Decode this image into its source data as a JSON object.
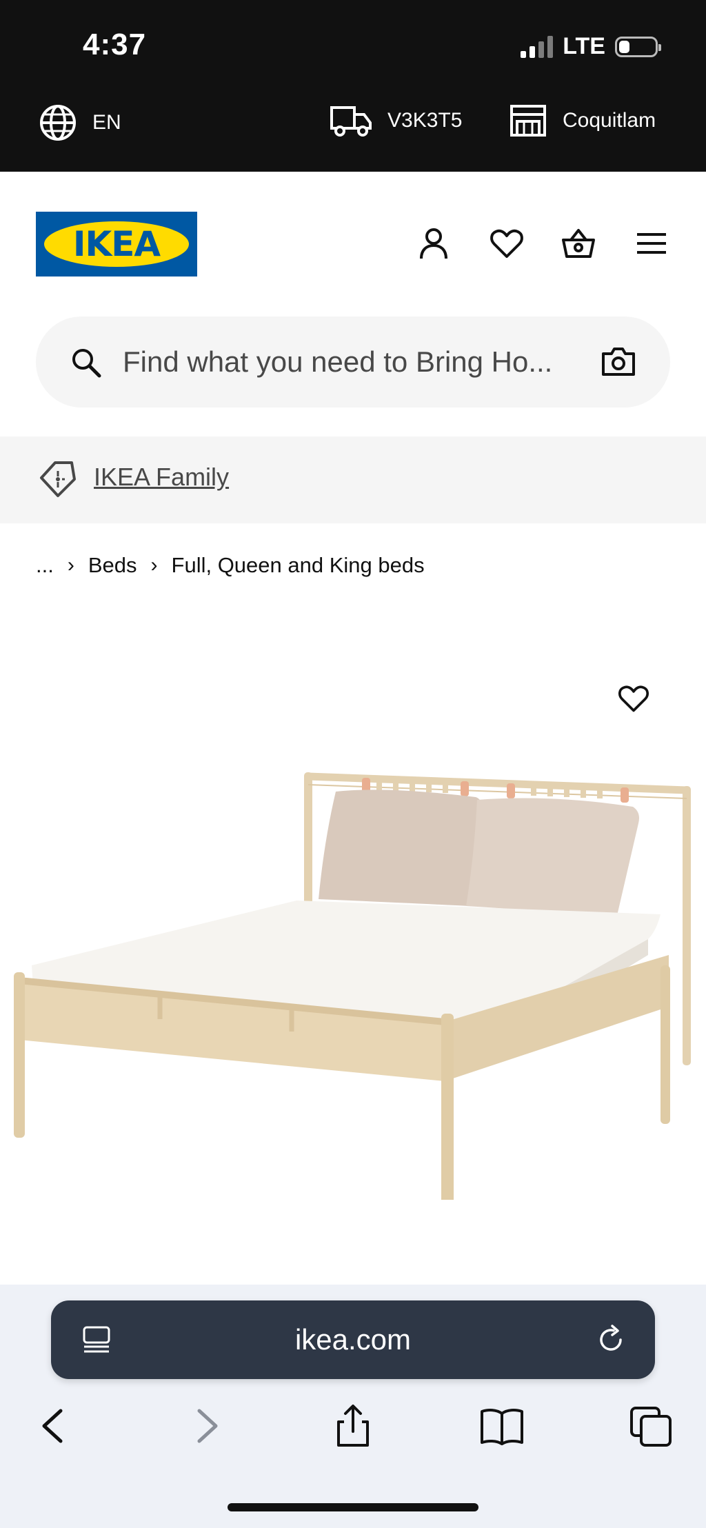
{
  "status_bar": {
    "time": "4:37",
    "network": "LTE",
    "signal_bars": 2,
    "battery_level": 0.3
  },
  "top_strip": {
    "language": "EN",
    "postal_code": "V3K3T5",
    "store": "Coquitlam"
  },
  "header": {
    "logo_text": "IKEA",
    "brand_colors": {
      "blue": "#0058A3",
      "yellow": "#FFDB00"
    },
    "icons": [
      "account-icon",
      "heart-icon",
      "basket-icon",
      "menu-icon"
    ]
  },
  "search": {
    "placeholder": "Find what you need to Bring Ho..."
  },
  "family_banner": {
    "label": "IKEA Family"
  },
  "breadcrumb": {
    "items": [
      "...",
      "Beds",
      "Full, Queen and King beds"
    ]
  },
  "browser": {
    "url": "ikea.com"
  }
}
